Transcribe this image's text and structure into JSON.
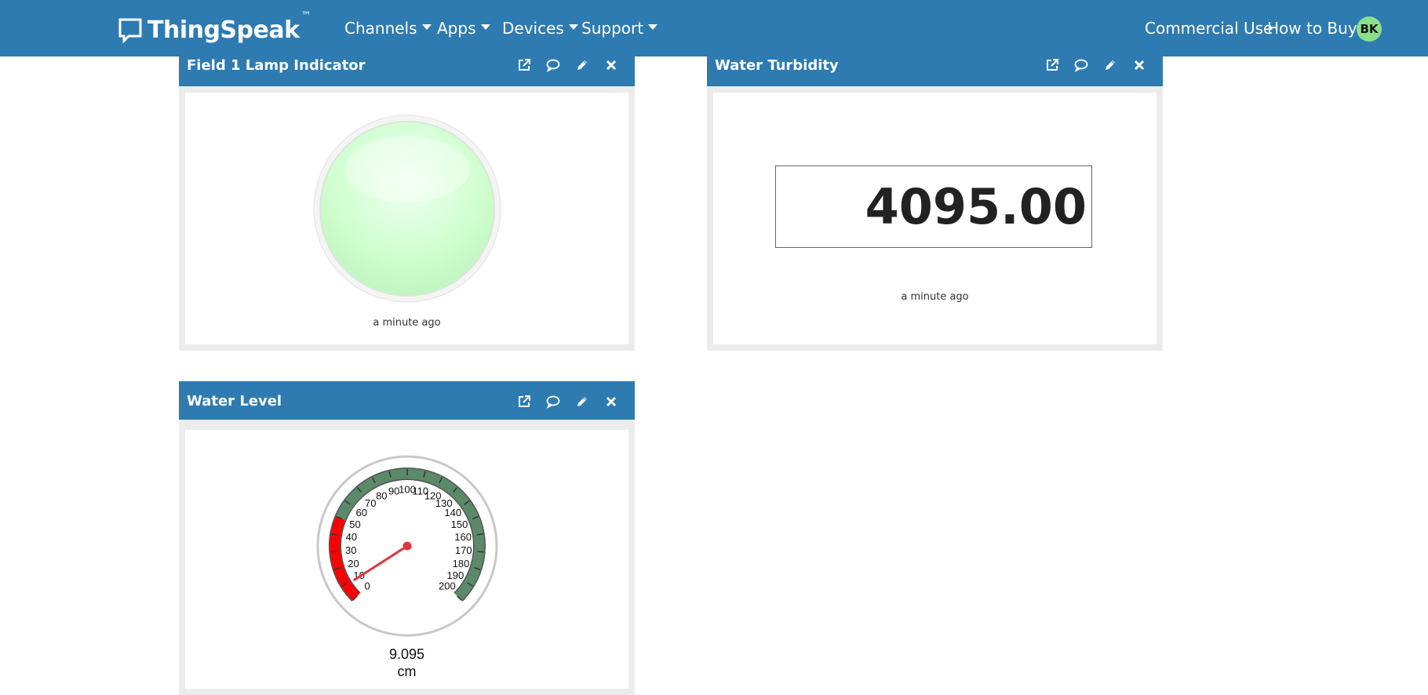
{
  "app": {
    "logo_text": "ThingSpeak",
    "logo_tm": "™",
    "brand_color": "#2e7bb2"
  },
  "nav": {
    "channels": "Channels",
    "apps": "Apps",
    "devices": "Devices",
    "support": "Support",
    "commercial_use": "Commercial Use",
    "how_to_buy": "How to Buy",
    "avatar_initials": "BK"
  },
  "widgets": {
    "lamp": {
      "title": "Field 1 Lamp Indicator",
      "timestamp": "a minute ago",
      "lamp_color": "#c8ffc8"
    },
    "turbidity": {
      "title": "Water Turbidity",
      "value": "4095.00",
      "timestamp": "a minute ago"
    },
    "level": {
      "title": "Water Level",
      "value": "9.095",
      "unit": "cm",
      "gauge": {
        "min": 0,
        "max": 200,
        "reading": 9.095,
        "ticks": [
          "0",
          "10",
          "20",
          "30",
          "40",
          "50",
          "60",
          "70",
          "80",
          "90",
          "100",
          "110",
          "120",
          "130",
          "140",
          "150",
          "160",
          "170",
          "180",
          "190",
          "200"
        ],
        "red_band": [
          0,
          50
        ],
        "green_band": [
          50,
          200
        ],
        "red_color": "#ff0000",
        "green_color": "#5b8a68",
        "needle_color": "#e0353f"
      }
    }
  },
  "icons": {
    "popout": "external-link-icon",
    "comment": "comment-icon",
    "edit": "pencil-icon",
    "close": "close-icon"
  }
}
